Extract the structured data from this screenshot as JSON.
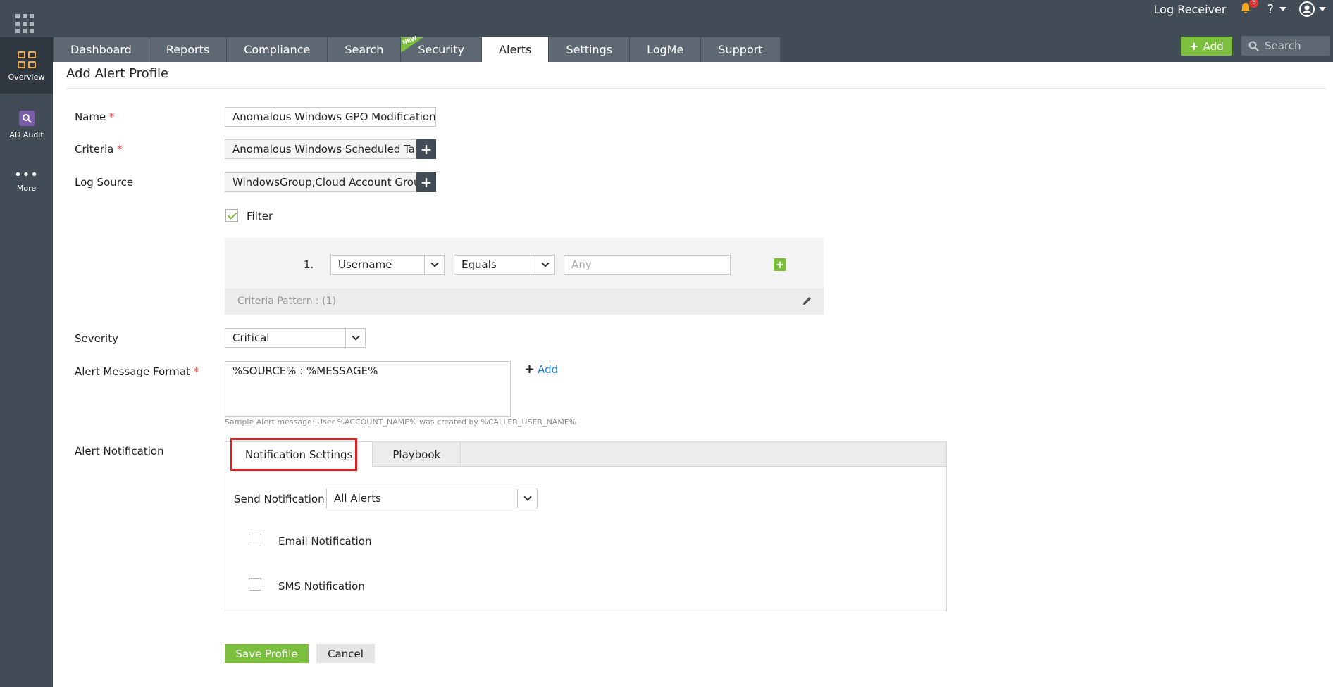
{
  "topbar": {
    "app_name": "Log Receiver",
    "notification_count": "5",
    "help_label": "?",
    "add_label": "Add",
    "search_placeholder": "Search"
  },
  "nav": {
    "tabs": [
      {
        "label": "Dashboard"
      },
      {
        "label": "Reports"
      },
      {
        "label": "Compliance"
      },
      {
        "label": "Search"
      },
      {
        "label": "Security",
        "badge": "NEW"
      },
      {
        "label": "Alerts",
        "active": true
      },
      {
        "label": "Settings"
      },
      {
        "label": "LogMe"
      },
      {
        "label": "Support"
      }
    ]
  },
  "sidebar": {
    "items": [
      {
        "label": "Overview",
        "icon": "overview-icon"
      },
      {
        "label": "AD Audit",
        "icon": "ad-audit-icon"
      },
      {
        "label": "More",
        "icon": "more-icon"
      }
    ]
  },
  "page": {
    "title": "Add Alert Profile"
  },
  "form": {
    "name_label": "Name",
    "name_value": "Anomalous Windows GPO Modification",
    "criteria_label": "Criteria",
    "criteria_value": "Anomalous Windows Scheduled Task",
    "log_source_label": "Log Source",
    "log_source_value": "WindowsGroup,Cloud Account Group",
    "required_mark": "*",
    "filter_label": "Filter",
    "filter_row_number": "1.",
    "filter_field": "Username",
    "filter_operator": "Equals",
    "filter_value_placeholder": "Any",
    "criteria_pattern": "Criteria Pattern : (1)",
    "severity_label": "Severity",
    "severity_value": "Critical",
    "message_format_label": "Alert Message Format",
    "message_format_value": "%SOURCE% : %MESSAGE%",
    "add_link": "Add",
    "sample_message": "Sample Alert message: User %ACCOUNT_NAME% was created by %CALLER_USER_NAME%",
    "alert_notification_label": "Alert Notification"
  },
  "notification": {
    "tabs": [
      {
        "label": "Notification Settings",
        "active": true
      },
      {
        "label": "Playbook"
      }
    ],
    "send_label": "Send Notification",
    "send_value": "All Alerts",
    "email_label": "Email Notification",
    "sms_label": "SMS Notification"
  },
  "actions": {
    "save_label": "Save Profile",
    "cancel_label": "Cancel"
  }
}
